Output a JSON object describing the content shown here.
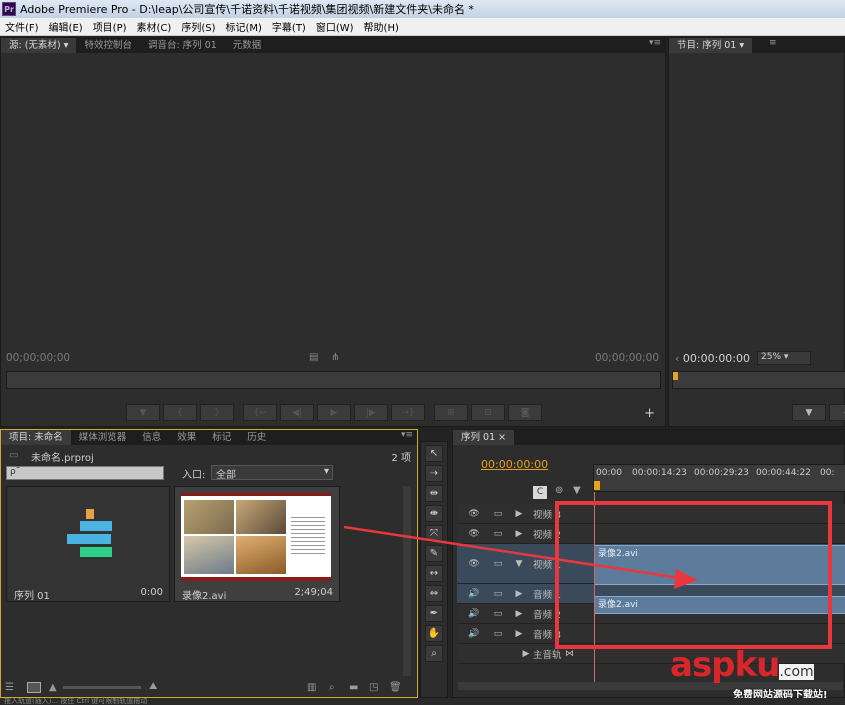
{
  "app": {
    "title": "Adobe Premiere Pro - D:\\leap\\公司宣传\\千诺资料\\千诺视频\\集团视频\\新建文件夹\\未命名 *",
    "logo": "Pr"
  },
  "menu": [
    "文件(F)",
    "编辑(E)",
    "项目(P)",
    "素材(C)",
    "序列(S)",
    "标记(M)",
    "字幕(T)",
    "窗口(W)",
    "帮助(H)"
  ],
  "source_panel": {
    "tabs": [
      "源: (无素材)",
      "特效控制台",
      "调音台: 序列 01",
      "元数据"
    ],
    "timecode_left": "00;00;00;00",
    "timecode_right": "00;00;00;00"
  },
  "program_panel": {
    "tabs": [
      "节目: 序列 01"
    ],
    "timecode": "00:00:00:00",
    "zoom": "25%"
  },
  "project_panel": {
    "tabs": [
      "项目: 未命名",
      "媒体浏览器",
      "信息",
      "效果",
      "标记",
      "历史"
    ],
    "file": "未命名.prproj",
    "count": "2 项",
    "search_placeholder": "ρ˜",
    "entry_label": "入口:",
    "entry_value": "全部",
    "items": [
      {
        "name": "序列 01",
        "duration": "0:00"
      },
      {
        "name": "录像2.avi",
        "duration": "2;49;04"
      }
    ]
  },
  "timeline": {
    "tab": "序列 01",
    "timecode": "00:00:00:00",
    "ruler": [
      "00:00",
      "00:00:14:23",
      "00:00:29:23",
      "00:00:44:22",
      "00:"
    ],
    "tracks": [
      {
        "label": "视频 3"
      },
      {
        "label": "视频 2"
      },
      {
        "label": "视频 1"
      },
      {
        "label": "音频 1"
      },
      {
        "label": "音频 2"
      },
      {
        "label": "音频 3"
      },
      {
        "label": "主音轨"
      }
    ],
    "clips": [
      {
        "label": "录像2.avi"
      },
      {
        "label": "录像2.avi"
      }
    ]
  },
  "watermark": {
    "brand": "aspku",
    "suffix": ".com",
    "slogan": "免费网站源码下载站!"
  },
  "status": "拖入轨道(插入)... 按住 Ctrl 键可限制轨道拖动",
  "colors": {
    "accent_timecode": "#e6a21b",
    "highlight_box": "#e8383d",
    "clip_blue": "#5d7c9c"
  }
}
